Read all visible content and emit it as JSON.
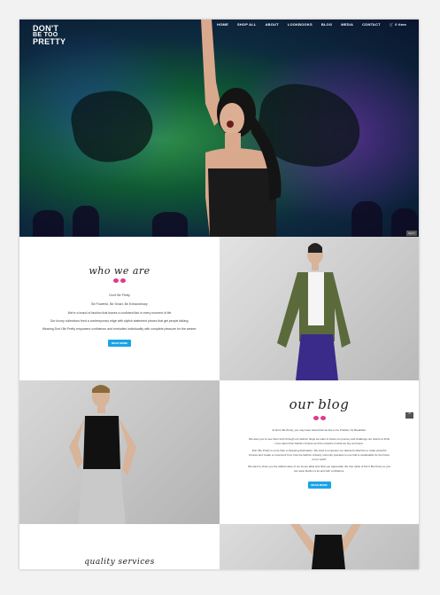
{
  "nav": {
    "logo": [
      "DON'T",
      "BE TOO",
      "PRETTY"
    ],
    "items": [
      "HOME",
      "SHOP ALL",
      "ABOUT",
      "LOOKBOOKS",
      "BLOG",
      "MEDIA",
      "CONTACT",
      "0 item"
    ]
  },
  "hero": {
    "tag": "NEXT"
  },
  "about": {
    "title": "who we are",
    "lines": [
      "Don't Be Pretty",
      "Be Powerful, Be Smart, Be Extraordinary",
      "We're a brand of fashion that leaves a confident flair in every moment of life",
      "Our luxury collections feed a contemporary edge with stylish statement pieces that get people talking.",
      "Wearing Don't Be Pretty empowers confidence and embodies individuality with complete pleasure for the wearer."
    ],
    "button": "READ MORE"
  },
  "blog": {
    "title": "our blog",
    "lines": [
      "At Don't Be Pretty, you may have heard that we like to be Problem for Breakfast.",
      "We want you to see them both through our fashion blogs we want to share our journey and challenge our clients to think",
      "more about their fashion choices and the impacts of what we buy and wear.",
      "Don't Be Pretty is more than a shopping destination. We want to empower our talented collective to make powerful",
      "choices and create a movement from how the fashion industry currently operates to one that is sustainable for the future",
      "of our world.",
      "We want to show you the added value of our luxury label and help you appreciate the true value of Don't Be Pretty so you",
      "can wear fashion a lot and with confidence."
    ],
    "button": "READ MORE"
  },
  "services": {
    "title": "quality services"
  },
  "colors": {
    "accent": "#1aa4e6",
    "bow": "#e23a8b"
  }
}
